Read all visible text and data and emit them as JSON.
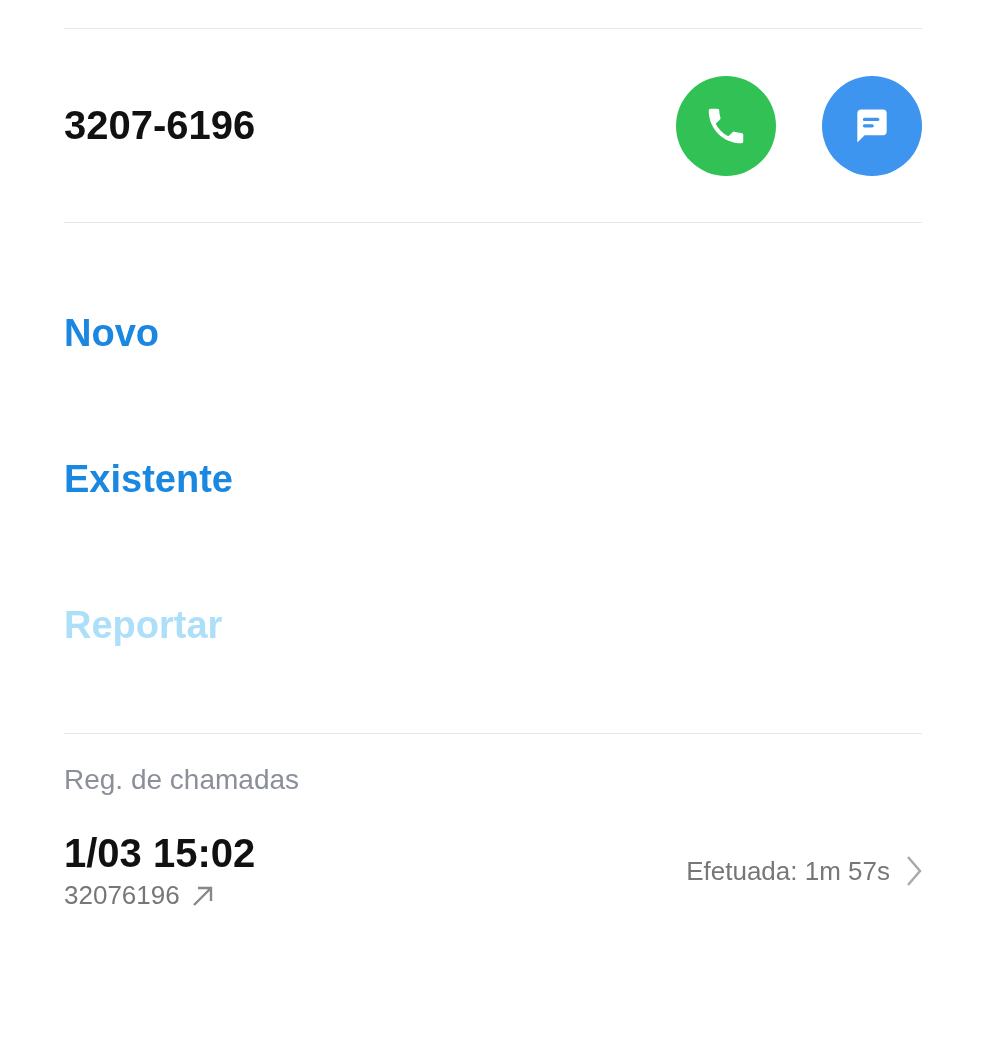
{
  "contact": {
    "number": "3207-6196",
    "actions": [
      {
        "kind": "call"
      },
      {
        "kind": "message"
      }
    ]
  },
  "options": [
    {
      "label": "Novo",
      "disabled": false
    },
    {
      "label": "Existente",
      "disabled": false
    },
    {
      "label": "Reportar",
      "disabled": true
    }
  ],
  "call_log": {
    "title": "Reg. de chamadas",
    "entries": [
      {
        "datetime": "1/03 15:02",
        "number": "32076196",
        "outgoing": true,
        "status": "Efetuada: 1m 57s"
      }
    ]
  }
}
